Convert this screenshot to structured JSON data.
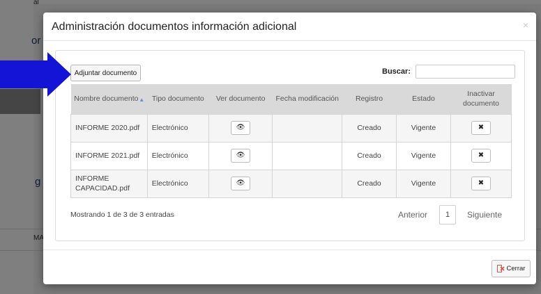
{
  "background": {
    "fragments": [
      "al",
      "or",
      "g",
      "MA"
    ]
  },
  "modal": {
    "title": "Administración documentos información adicional",
    "close_symbol": "×",
    "attach_label": "Adjuntar documento",
    "search": {
      "label": "Buscar:",
      "value": ""
    },
    "table": {
      "headers": [
        "Nombre documento",
        "Tipo documento",
        "Ver documento",
        "Fecha modificación",
        "Registro",
        "Estado",
        "Inactivar documento"
      ],
      "rows": [
        {
          "name": "INFORME 2020.pdf",
          "type": "Electrónico",
          "date": "",
          "registro": "Creado",
          "estado": "Vigente"
        },
        {
          "name": "INFORME 2021.pdf",
          "type": "Electrónico",
          "date": "",
          "registro": "Creado",
          "estado": "Vigente"
        },
        {
          "name": "INFORME CAPACIDAD.pdf",
          "type": "Electrónico",
          "date": "",
          "registro": "Creado",
          "estado": "Vigente"
        }
      ]
    },
    "info": "Mostrando 1 de 3 de 3 entradas",
    "pagination": {
      "prev": "Anterior",
      "page": "1",
      "next": "Siguiente"
    },
    "close_button": "Cerrar"
  },
  "colors": {
    "arrow": "#1414d6",
    "header_bg": "#d9d9d9",
    "overlay": "#808080"
  },
  "icons": {
    "view": "eye-icon",
    "deactivate": "x-icon",
    "close_button": "close-file-icon"
  }
}
